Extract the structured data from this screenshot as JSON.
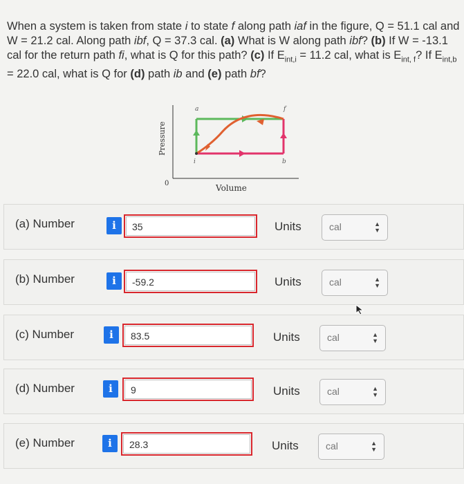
{
  "question": {
    "p1": "When a system is taken from state ",
    "p2": "i",
    "p3": " to state ",
    "p4": "f",
    "p5": " along path ",
    "p6": "iaf",
    "p7": " in the figure, Q = 51.1 cal and W = 21.2 cal. Along path ",
    "p8": "ibf",
    "p9": ", Q = 37.3 cal. ",
    "p10": "(a)",
    "p11": " What is W along path ",
    "p12": "ibf",
    "p13": "? ",
    "p14": "(b)",
    "p15": " If W = -13.1 cal for the return path ",
    "p16": "fi",
    "p17": ", what is Q for this path? ",
    "p18": "(c)",
    "p19": " If E",
    "p20": "int,i",
    "p21": " = 11.2 cal, what is E",
    "p22": "int, f",
    "p23": "? If E",
    "p24": "int,b",
    "p25": " = 22.0 cal, what is Q for ",
    "p26": "(d)",
    "p27": " path ",
    "p28": "ib",
    "p29": " and ",
    "p30": "(e)",
    "p31": " path ",
    "p32": "bf",
    "p33": "?"
  },
  "figure": {
    "ylabel": "Pressure",
    "xlabel": "Volume",
    "origin": "0",
    "points": {
      "a": "a",
      "f": "f",
      "i": "i",
      "b": "b"
    },
    "colors": {
      "green": "#5cb85c",
      "red": "#e74c3c",
      "magenta": "#e2336b",
      "curve": "#e06030"
    }
  },
  "answers": [
    {
      "label": "(a)  Number",
      "value": "35",
      "units_label": "Units",
      "unit": "cal"
    },
    {
      "label": "(b)  Number",
      "value": "-59.2",
      "units_label": "Units",
      "unit": "cal"
    },
    {
      "label": "(c)  Number",
      "value": "83.5",
      "units_label": "Units",
      "unit": "cal"
    },
    {
      "label": "(d)  Number",
      "value": "9",
      "units_label": "Units",
      "unit": "cal"
    },
    {
      "label": "(e)  Number",
      "value": "28.3",
      "units_label": "Units",
      "unit": "cal"
    }
  ],
  "info_icon": "i",
  "colors": {
    "info": "#1e73e8",
    "error_border": "#d8262c"
  }
}
